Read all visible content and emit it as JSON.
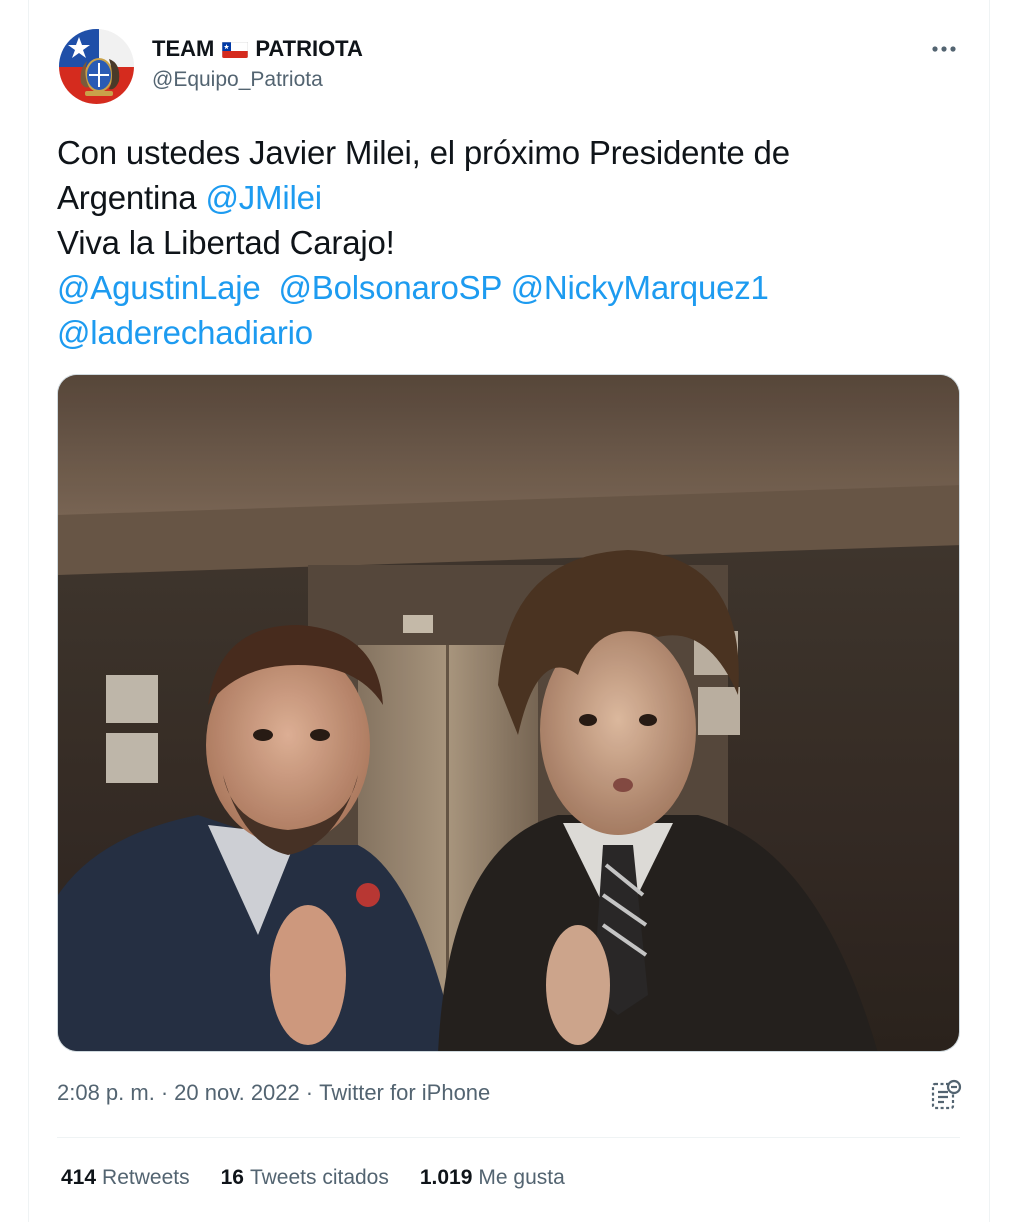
{
  "author": {
    "name_part1": "TEAM",
    "flag_icon": "chile-flag-icon",
    "name_part2": "PATRIOTA",
    "handle": "@Equipo_Patriota"
  },
  "tweet": {
    "lines": [
      [
        {
          "text": "Con ustedes Javier Milei, el próximo Presidente de",
          "mention": false
        }
      ],
      [
        {
          "text": "Argentina ",
          "mention": false
        },
        {
          "text": "@JMilei",
          "mention": true
        }
      ],
      [
        {
          "text": "Viva la Libertad Carajo!",
          "mention": false
        }
      ],
      [
        {
          "text": "@AgustinLaje",
          "mention": true
        },
        {
          "text": "  ",
          "mention": false
        },
        {
          "text": "@BolsonaroSP",
          "mention": true
        },
        {
          "text": " ",
          "mention": false
        },
        {
          "text": "@NickyMarquez1",
          "mention": true
        }
      ],
      [
        {
          "text": "@laderechadiario",
          "mention": true
        }
      ]
    ]
  },
  "meta": {
    "time": "2:08 p. m.",
    "date": "20 nov. 2022",
    "separator": "·",
    "source": "Twitter for iPhone"
  },
  "stats": {
    "retweets_count": "414",
    "retweets_label": "Retweets",
    "quotes_count": "16",
    "quotes_label": "Tweets citados",
    "likes_count": "1.019",
    "likes_label": "Me gusta"
  },
  "colors": {
    "link": "#1d9bf0",
    "secondary_text": "#536471",
    "primary_text": "#0f1419"
  },
  "icons": {
    "more": "more-horizontal-icon",
    "analytics": "analytics-icon"
  }
}
